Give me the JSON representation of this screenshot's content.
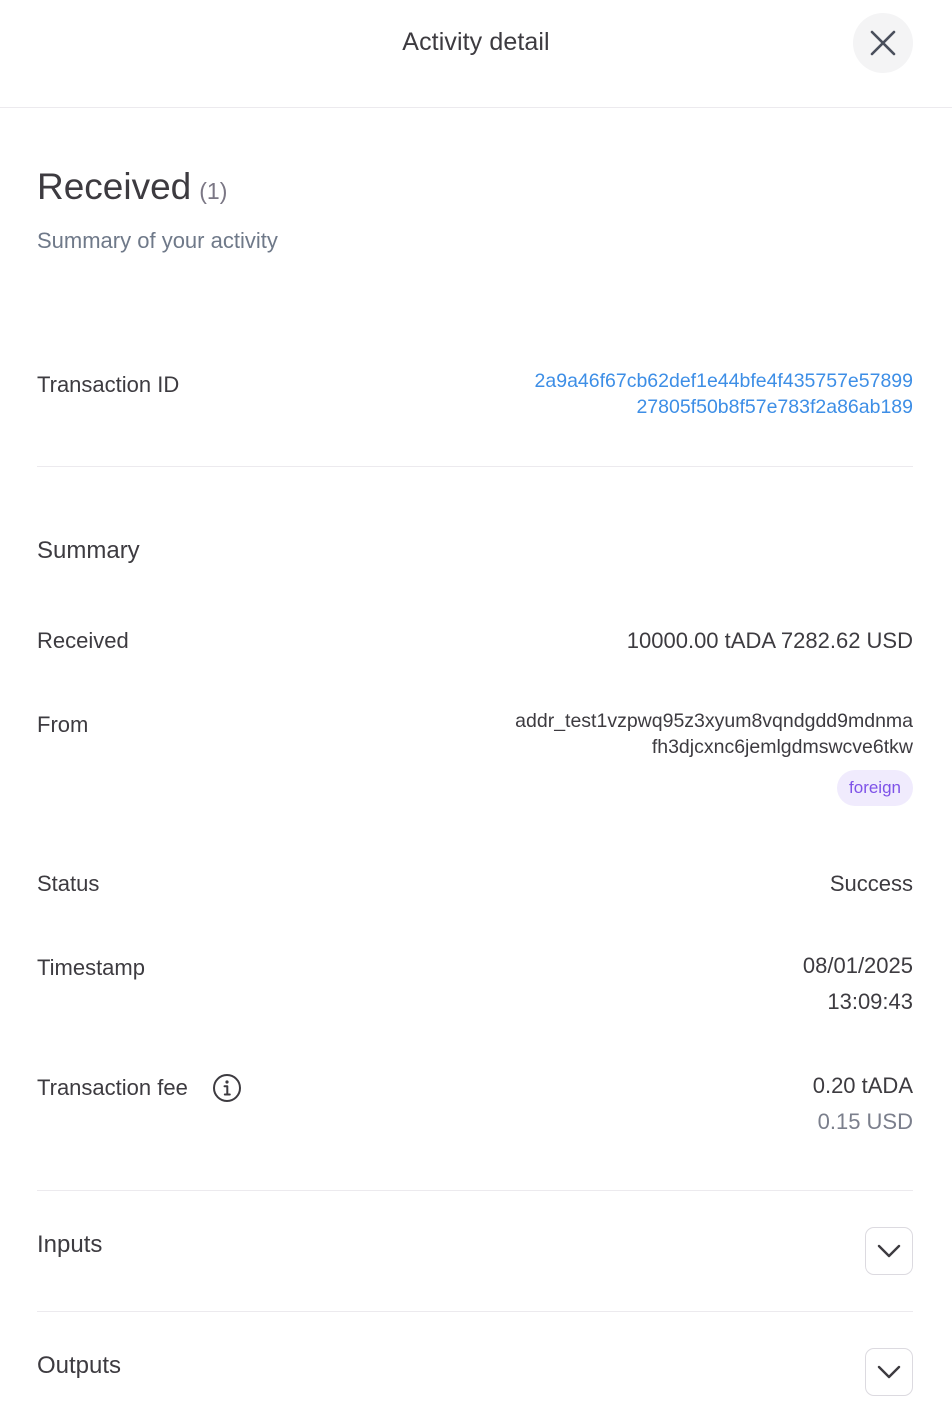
{
  "header": {
    "title": "Activity detail",
    "close_icon": "close-icon"
  },
  "page": {
    "heading": "Received",
    "count": "(1)",
    "subtitle": "Summary of your activity"
  },
  "transaction": {
    "label": "Transaction ID",
    "id_line1": "2a9a46f67cb62def1e44bfe4f435757e57899",
    "id_line2": "27805f50b8f57e783f2a86ab189"
  },
  "summary": {
    "title": "Summary",
    "received_label": "Received",
    "received_value": "10000.00 tADA 7282.62 USD",
    "from_label": "From",
    "from_line1": "addr_test1vzpwq95z3xyum8vqndgdd9mdnma",
    "from_line2": "fh3djcxnc6jemlgdmswcve6tkw",
    "from_badge": "foreign",
    "status_label": "Status",
    "status_value": "Success",
    "timestamp_label": "Timestamp",
    "timestamp_date": "08/01/2025",
    "timestamp_time": "13:09:43",
    "fee_label": "Transaction fee",
    "fee_icon": "info-icon",
    "fee_ada": "0.20 tADA",
    "fee_usd": "0.15 USD"
  },
  "sections": {
    "inputs_label": "Inputs",
    "outputs_label": "Outputs",
    "expand_icon": "chevron-down-icon"
  },
  "colors": {
    "link": "#3d8ee6",
    "badge_bg": "#f0ebfd",
    "badge_text": "#7e52e8",
    "text": "#3d3b40",
    "muted": "#6f7989"
  }
}
